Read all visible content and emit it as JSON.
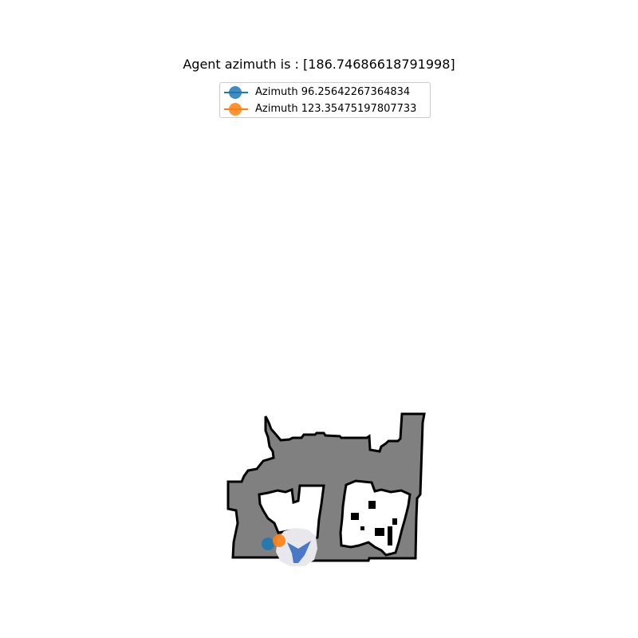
{
  "title": "Agent azimuth is : [186.74686618791998]",
  "legend": {
    "items": [
      {
        "label": "Azimuth 96.25642267364834",
        "color": "#1f77b4"
      },
      {
        "label": "Azimuth 123.35475197807733",
        "color": "#ff7f0e"
      }
    ]
  },
  "map": {
    "colors": {
      "explored": "#808080",
      "obstacle_border": "#000000",
      "free": "#ffffff",
      "agent_fov": "#e8e8ec",
      "agent_marker": "#4a78c8"
    }
  }
}
